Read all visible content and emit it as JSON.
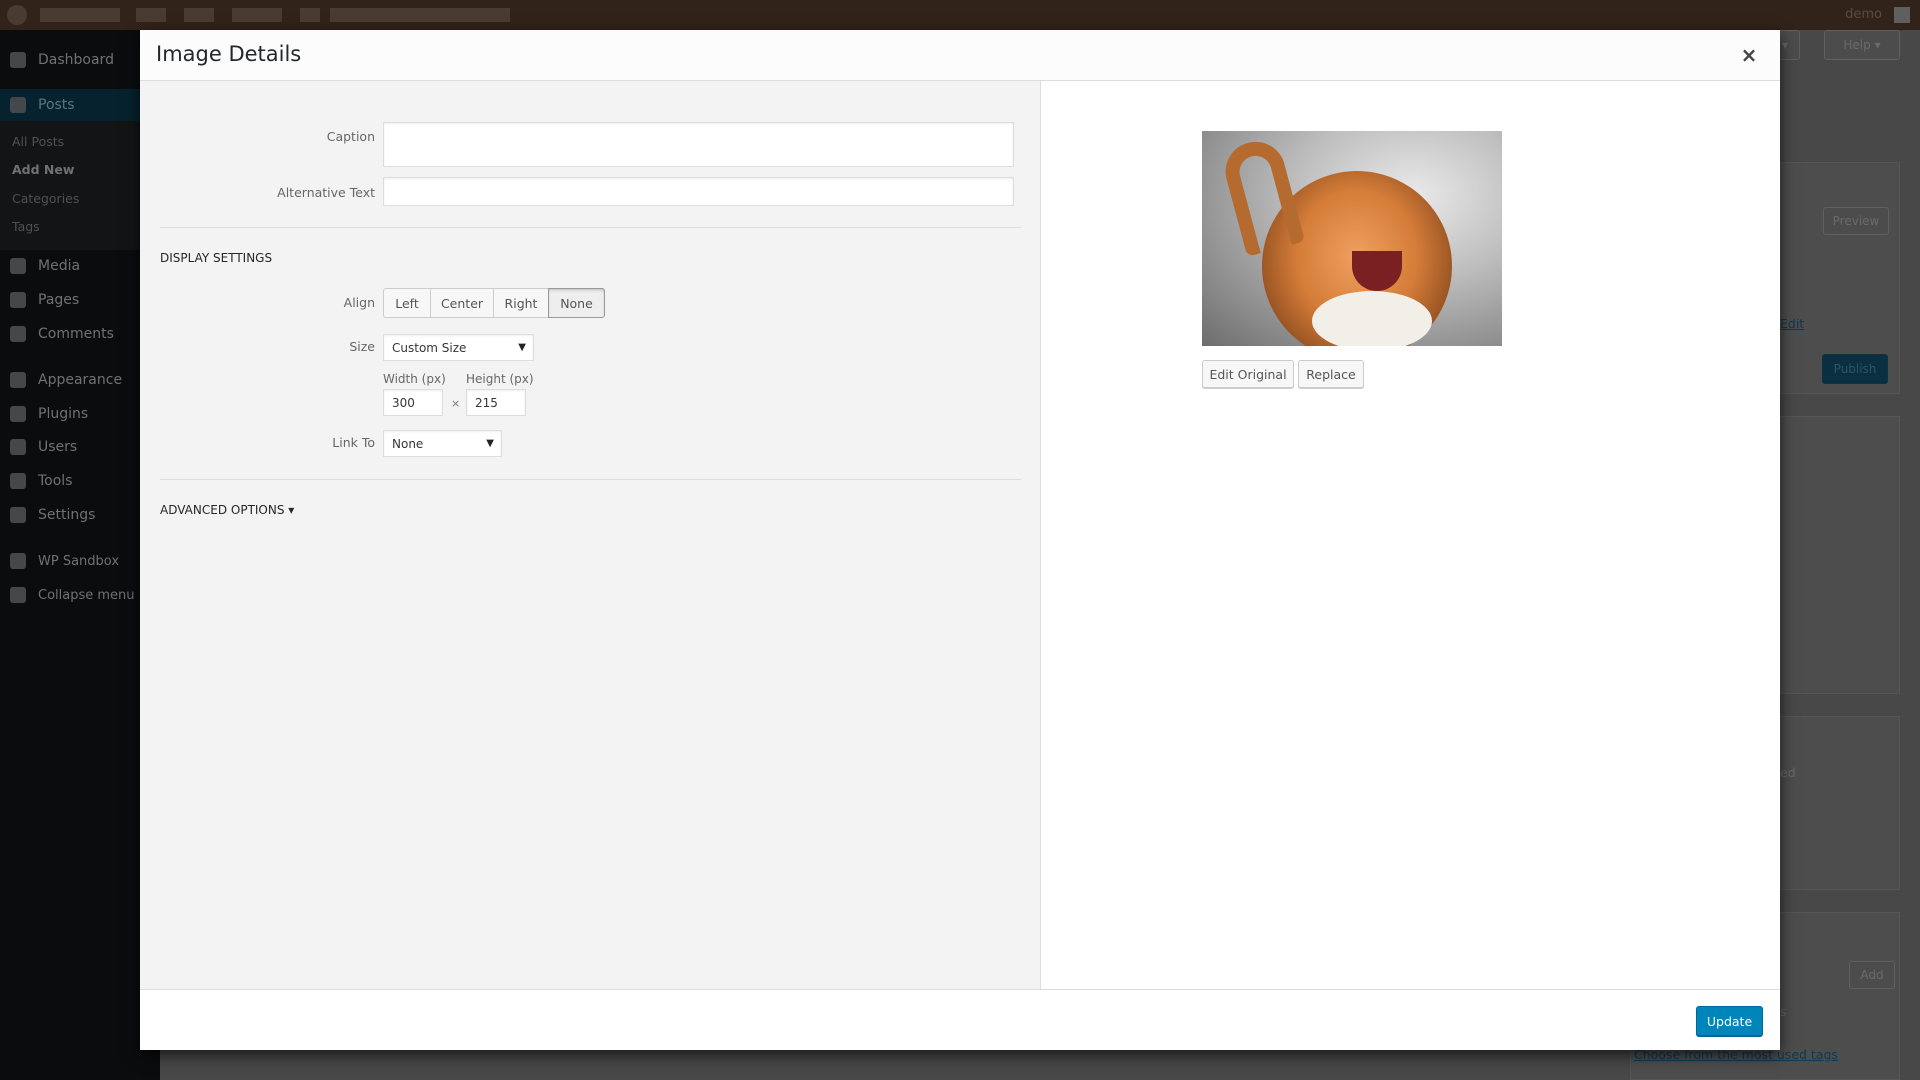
{
  "admin_bar": {
    "user": "demo"
  },
  "sidebar": {
    "items": [
      {
        "label": "Dashboard",
        "icon": "dashboard-icon"
      },
      {
        "label": "Posts",
        "icon": "pin-icon"
      },
      {
        "label": "Media",
        "icon": "media-icon"
      },
      {
        "label": "Pages",
        "icon": "pages-icon"
      },
      {
        "label": "Comments",
        "icon": "comment-icon"
      },
      {
        "label": "Appearance",
        "icon": "brush-icon"
      },
      {
        "label": "Plugins",
        "icon": "plugin-icon"
      },
      {
        "label": "Users",
        "icon": "user-icon"
      },
      {
        "label": "Tools",
        "icon": "wrench-icon"
      },
      {
        "label": "Settings",
        "icon": "settings-icon"
      },
      {
        "label": "WP Sandbox",
        "icon": "sandbox-icon"
      },
      {
        "label": "Collapse menu",
        "icon": "collapse-icon"
      }
    ],
    "posts_submenu": [
      "All Posts",
      "Add New",
      "Categories",
      "Tags"
    ]
  },
  "background": {
    "help": "Help ▾",
    "screen_options": "s ▾",
    "preview": "Preview",
    "edit": "Edit",
    "publish": "Publish",
    "partial": "ed",
    "add": "Add",
    "partial2": "s",
    "tags_link": "Choose from the most used tags"
  },
  "modal": {
    "title": "Image Details",
    "close": "×",
    "caption_label": "Caption",
    "caption_value": "",
    "alt_label": "Alternative Text",
    "alt_value": "",
    "display_settings": "Display Settings",
    "align_label": "Align",
    "align_options": [
      "Left",
      "Center",
      "Right",
      "None"
    ],
    "align_selected": "None",
    "size_label": "Size",
    "size_value": "Custom Size",
    "width_label": "Width (px)",
    "height_label": "Height (px)",
    "width_value": "300",
    "height_value": "215",
    "times": "×",
    "link_label": "Link To",
    "link_value": "None",
    "advanced": "Advanced Options ▾",
    "edit_original": "Edit Original",
    "replace": "Replace",
    "update": "Update"
  },
  "colors": {
    "primary": "#0085ba",
    "sidebar_active": "#0073aa"
  }
}
